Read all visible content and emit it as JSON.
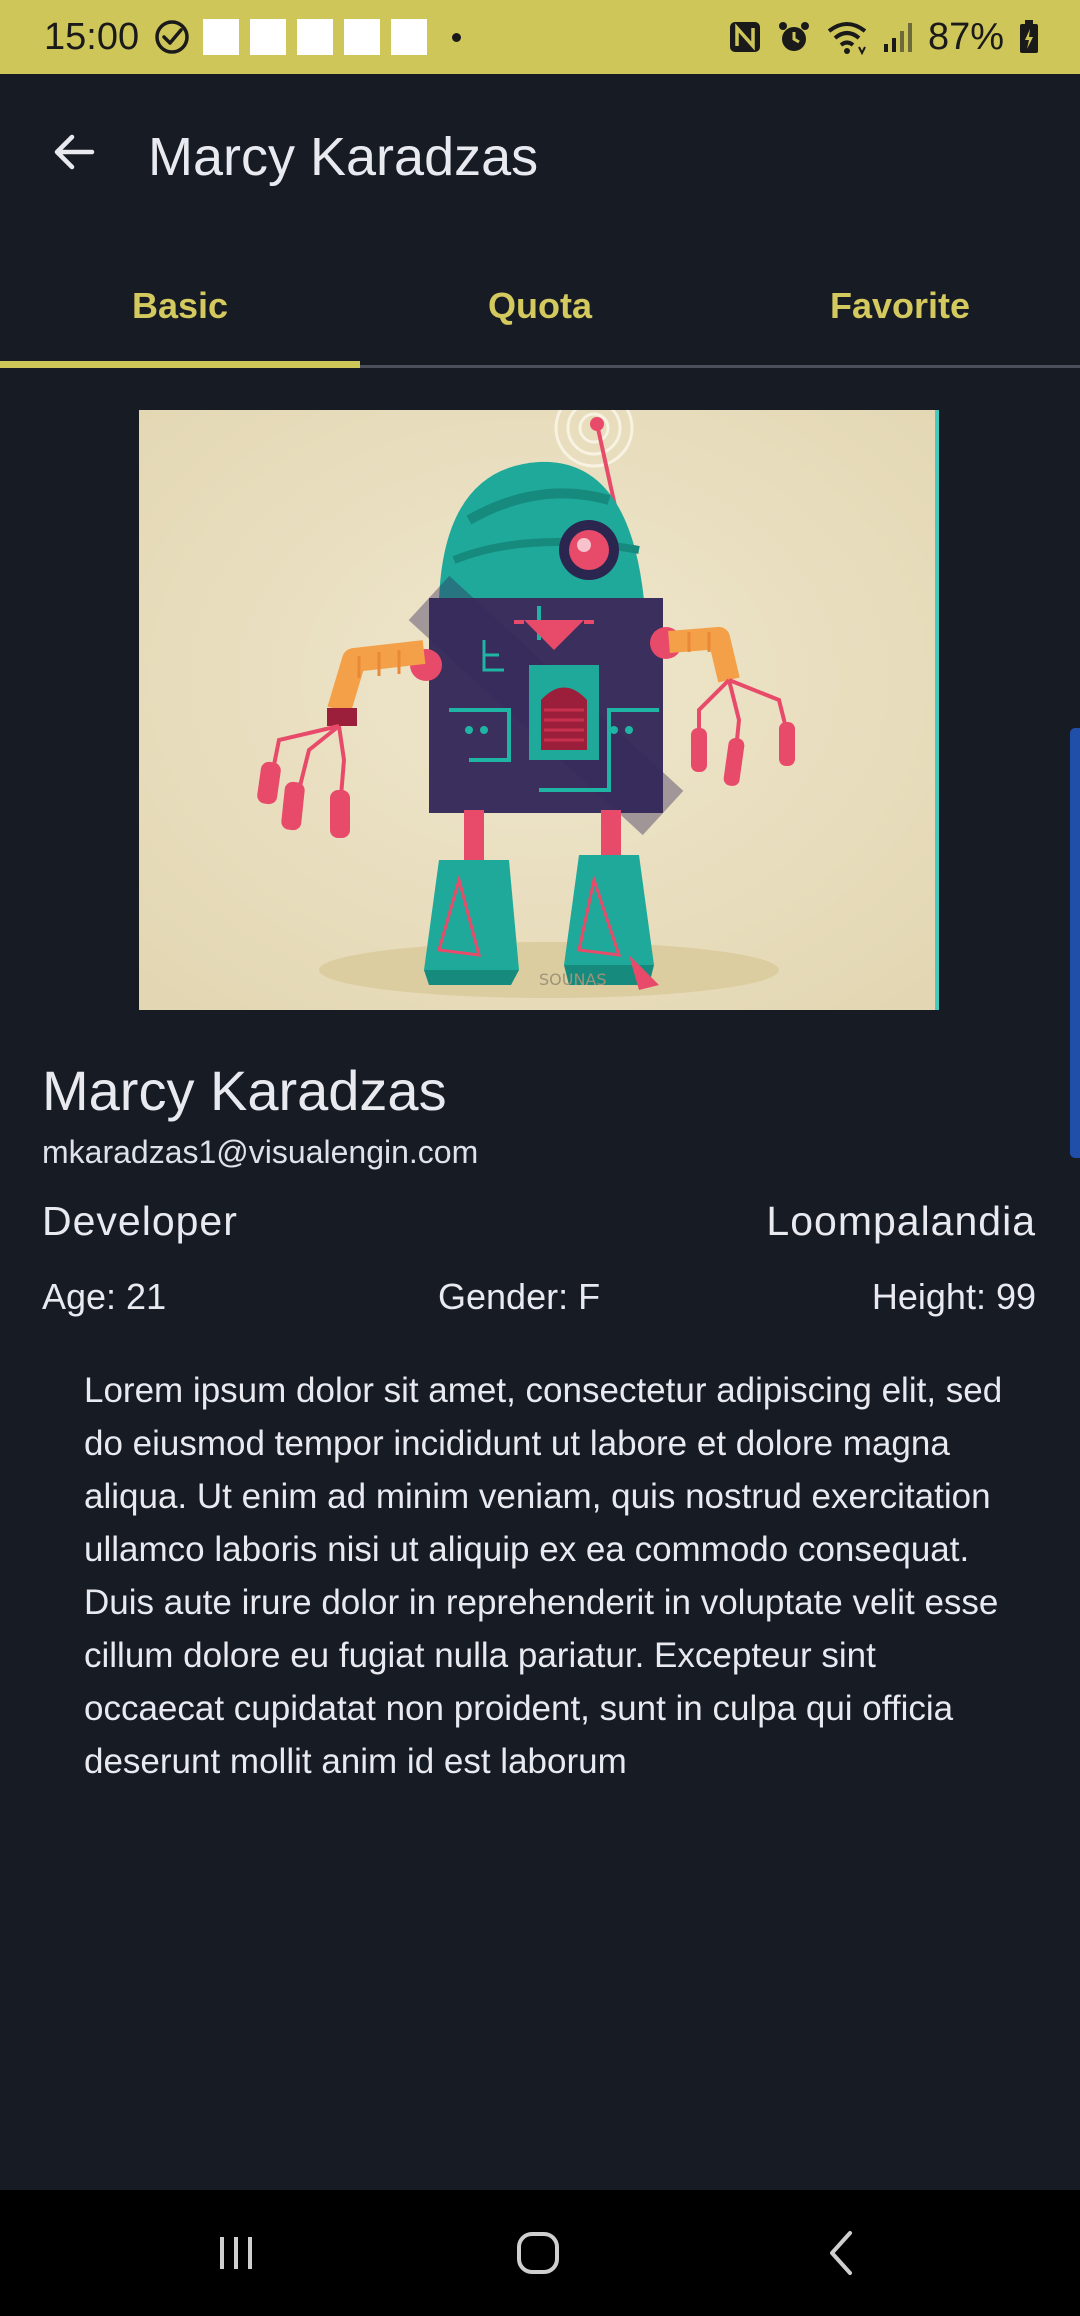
{
  "status_bar": {
    "time": "15:00",
    "battery": "87%",
    "icons": [
      "check-circle-icon",
      "nfc-icon",
      "alarm-icon",
      "wifi-icon",
      "signal-icon",
      "battery-charging-icon"
    ]
  },
  "app_bar": {
    "title": "Marcy Karadzas",
    "back_icon": "arrow-left-icon"
  },
  "tabs": [
    {
      "label": "Basic",
      "active": true
    },
    {
      "label": "Quota",
      "active": false
    },
    {
      "label": "Favorite",
      "active": false
    }
  ],
  "profile": {
    "image_signature": "SOUNAS",
    "name": "Marcy Karadzas",
    "email": "mkaradzas1@visualengin.com",
    "role": "Developer",
    "location": "Loompalandia",
    "age": "Age: 21",
    "gender": "Gender: F",
    "height": "Height: 99",
    "bio": "Lorem ipsum dolor sit amet, consectetur adipiscing elit, sed do eiusmod tempor incididunt ut labore et dolore magna aliqua. Ut enim ad minim veniam, quis nostrud exercitation ullamco laboris nisi ut aliquip ex ea commodo consequat. Duis aute irure dolor in reprehenderit in voluptate velit esse cillum dolore eu fugiat nulla pariatur. Excepteur sint occaecat cupidatat non proident, sunt in culpa qui officia deserunt mollit anim id est laborum"
  },
  "nav_bar": {
    "icons": [
      "recent-apps-icon",
      "home-icon",
      "back-icon"
    ]
  },
  "colors": {
    "accent": "#cfc65a",
    "tab_text": "#d4c95e",
    "background": "#171b24",
    "text": "#e8eaf0"
  }
}
